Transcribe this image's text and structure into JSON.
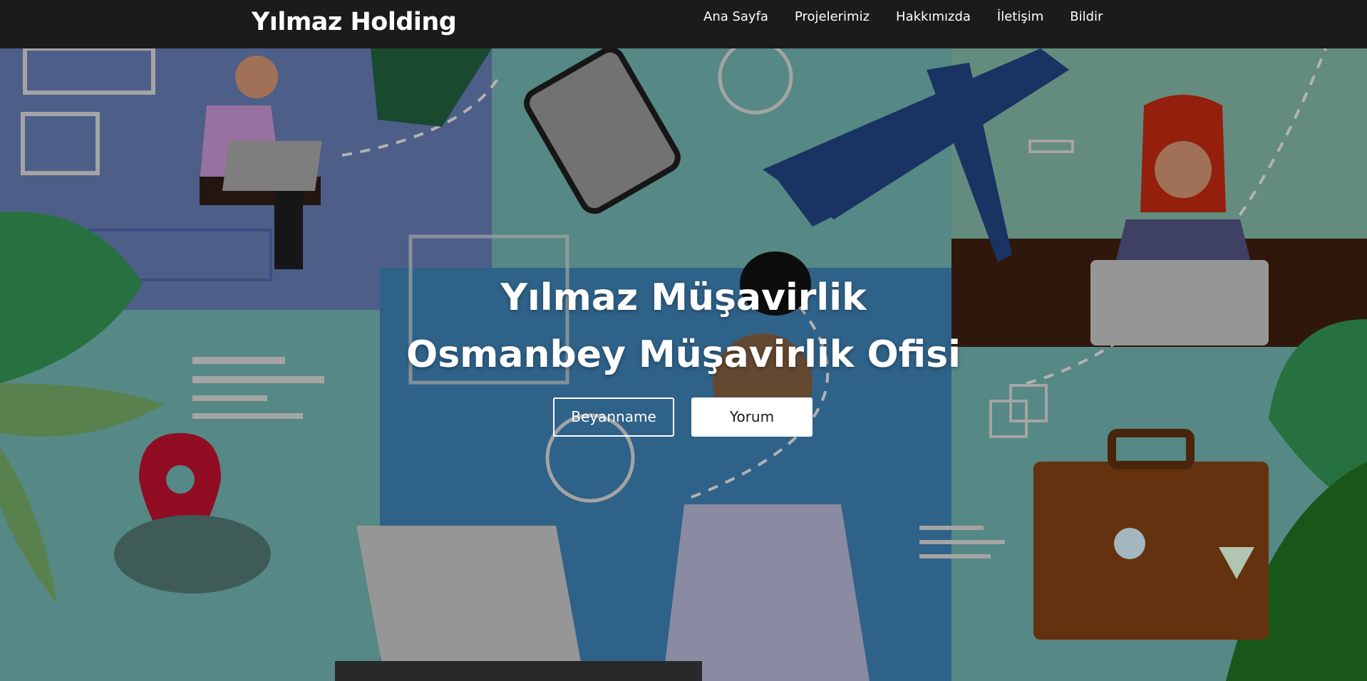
{
  "navbar": {
    "brand": "Yılmaz Holding",
    "links": [
      "Ana Sayfa",
      "Projelerimiz",
      "Hakkımızda",
      "İletişim",
      "Bildir"
    ]
  },
  "hero": {
    "title_line1": "Yılmaz Müşavirlik",
    "title_line2": "Osmanbey Müşavirlik Ofisi",
    "buttons": {
      "primary": "Beyanname",
      "secondary": "Yorum"
    }
  },
  "colors": {
    "navbar_bg": "#1b1b1b",
    "text": "#ffffff",
    "panel_blue": "#5e73a6",
    "panel_teal": "#6aa6a3",
    "panel_deep": "#3a78a6"
  }
}
